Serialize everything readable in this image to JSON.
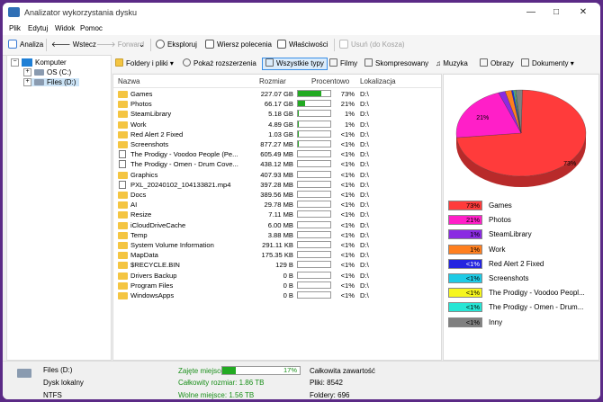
{
  "window": {
    "title": "Analizator wykorzystania dysku",
    "minimize": "—",
    "maximize": "□",
    "close": "✕"
  },
  "menu": [
    "Plik",
    "Edytuj",
    "Widok",
    "Pomoc"
  ],
  "toolbar": {
    "analyze": "Analiza",
    "back": "Wstecz",
    "forward": "Forward",
    "explore": "Eksploruj",
    "cmd": "Wiersz polecenia",
    "props": "Właściwości",
    "delete": "Usuń (do Kosza)"
  },
  "tree": {
    "root": "Komputer",
    "drives": [
      "OS (C:)",
      "Files (D:)"
    ]
  },
  "filters": {
    "folders_files": "Foldery i pliki",
    "extensions": "Pokaż rozszerzenia",
    "all_types": "Wszystkie typy",
    "movies": "Filmy",
    "compressed": "Skompresowany",
    "music": "Muzyka",
    "images": "Obrazy",
    "documents": "Dokumenty"
  },
  "columns": {
    "name": "Nazwa",
    "size": "Rozmiar",
    "percent": "Procentowo",
    "location": "Lokalizacja"
  },
  "rows": [
    {
      "name": "Games",
      "size": "227.07 GB",
      "percent": "73%",
      "pct_value": 73,
      "loc": "D:\\",
      "type": "folder"
    },
    {
      "name": "Photos",
      "size": "66.17 GB",
      "percent": "21%",
      "pct_value": 21,
      "loc": "D:\\",
      "type": "folder"
    },
    {
      "name": "SteamLibrary",
      "size": "5.18 GB",
      "percent": "1%",
      "pct_value": 1,
      "loc": "D:\\",
      "type": "folder"
    },
    {
      "name": "Work",
      "size": "4.89 GB",
      "percent": "1%",
      "pct_value": 1,
      "loc": "D:\\",
      "type": "folder"
    },
    {
      "name": "Red Alert 2 Fixed",
      "size": "1.03 GB",
      "percent": "<1%",
      "pct_value": 0.3,
      "loc": "D:\\",
      "type": "folder"
    },
    {
      "name": "Screenshots",
      "size": "877.27 MB",
      "percent": "<1%",
      "pct_value": 0.3,
      "loc": "D:\\",
      "type": "folder"
    },
    {
      "name": "The Prodigy - Voodoo People (Pe...",
      "size": "605.49 MB",
      "percent": "<1%",
      "pct_value": 0.2,
      "loc": "D:\\",
      "type": "file"
    },
    {
      "name": "The Prodigy - Omen - Drum Cove...",
      "size": "438.12 MB",
      "percent": "<1%",
      "pct_value": 0.1,
      "loc": "D:\\",
      "type": "file"
    },
    {
      "name": "Graphics",
      "size": "407.93 MB",
      "percent": "<1%",
      "pct_value": 0.1,
      "loc": "D:\\",
      "type": "folder"
    },
    {
      "name": "PXL_20240102_104133821.mp4",
      "size": "397.28 MB",
      "percent": "<1%",
      "pct_value": 0.1,
      "loc": "D:\\",
      "type": "file"
    },
    {
      "name": "Docs",
      "size": "389.56 MB",
      "percent": "<1%",
      "pct_value": 0.1,
      "loc": "D:\\",
      "type": "folder"
    },
    {
      "name": "AI",
      "size": "29.78 MB",
      "percent": "<1%",
      "pct_value": 0,
      "loc": "D:\\",
      "type": "folder"
    },
    {
      "name": "Resize",
      "size": "7.11 MB",
      "percent": "<1%",
      "pct_value": 0,
      "loc": "D:\\",
      "type": "folder"
    },
    {
      "name": "iCloudDriveCache",
      "size": "6.00 MB",
      "percent": "<1%",
      "pct_value": 0,
      "loc": "D:\\",
      "type": "folder"
    },
    {
      "name": "Temp",
      "size": "3.88 MB",
      "percent": "<1%",
      "pct_value": 0,
      "loc": "D:\\",
      "type": "folder"
    },
    {
      "name": "System Volume Information",
      "size": "291.11 KB",
      "percent": "<1%",
      "pct_value": 0,
      "loc": "D:\\",
      "type": "folder"
    },
    {
      "name": "MapData",
      "size": "175.35 KB",
      "percent": "<1%",
      "pct_value": 0,
      "loc": "D:\\",
      "type": "folder"
    },
    {
      "name": "$RECYCLE.BIN",
      "size": "129 B",
      "percent": "<1%",
      "pct_value": 0,
      "loc": "D:\\",
      "type": "folder"
    },
    {
      "name": "Drivers Backup",
      "size": "0 B",
      "percent": "<1%",
      "pct_value": 0,
      "loc": "D:\\",
      "type": "folder"
    },
    {
      "name": "Program Files",
      "size": "0 B",
      "percent": "<1%",
      "pct_value": 0,
      "loc": "D:\\",
      "type": "folder"
    },
    {
      "name": "WindowsApps",
      "size": "0 B",
      "percent": "<1%",
      "pct_value": 0,
      "loc": "D:\\",
      "type": "folder"
    }
  ],
  "chart_data": {
    "type": "pie",
    "slices": [
      {
        "name": "Games",
        "value": 73,
        "label": "73%",
        "color": "#ff3b3b"
      },
      {
        "name": "Photos",
        "value": 21,
        "label": "21%",
        "color": "#ff1fc8"
      },
      {
        "name": "SteamLibrary",
        "value": 1.7,
        "label": "1%",
        "color": "#8a2be2"
      },
      {
        "name": "Work",
        "value": 1.6,
        "label": "1%",
        "color": "#ff7f1f"
      },
      {
        "name": "Red Alert 2 Fixed",
        "value": 0.4,
        "label": "<1%",
        "color": "#2525e0"
      },
      {
        "name": "Screenshots",
        "value": 0.3,
        "label": "<1%",
        "color": "#1ecbe6"
      },
      {
        "name": "The Prodigy - Voodoo Peopl...",
        "value": 0.2,
        "label": "<1%",
        "color": "#f6f61e"
      },
      {
        "name": "The Prodigy - Omen - Drum...",
        "value": 0.2,
        "label": "<1%",
        "color": "#27e6d5"
      },
      {
        "name": "Inny",
        "value": 1.6,
        "label": "<1%",
        "color": "#808080"
      }
    ],
    "pie_labels": [
      "73%",
      "21%"
    ]
  },
  "status": {
    "drive": "Files (D:)",
    "drive_type": "Dysk lokalny",
    "fs": "NTFS",
    "used_label": "Zajęte miejsce:",
    "used_pct": "17%",
    "used_value": 17,
    "total_label": "Całkowity rozmiar: 1.86 TB",
    "free_label": "Wolne miejsce: 1.56 TB",
    "content_label": "Całkowita zawartość",
    "files": "Pliki: 8542",
    "folders": "Foldery: 696"
  }
}
